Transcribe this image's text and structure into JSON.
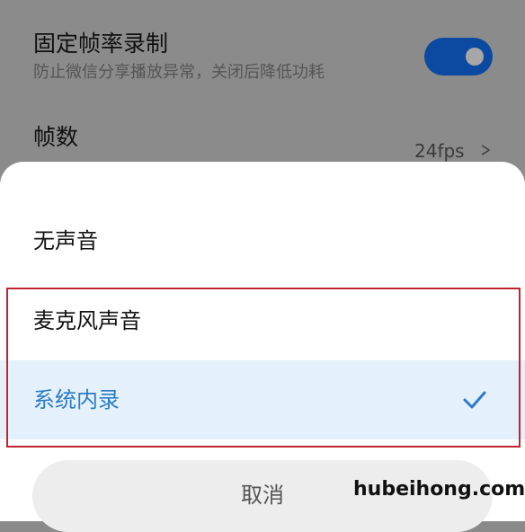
{
  "background_settings": {
    "fixed_frame_rate": {
      "title": "固定帧率录制",
      "subtitle": "防止微信分享播放异常，关闭后降低功耗",
      "toggle_on": true
    },
    "frame_rate": {
      "title": "帧数",
      "value": "24fps"
    }
  },
  "sound_sheet": {
    "options": [
      {
        "label": "无声音",
        "selected": false
      },
      {
        "label": "麦克风声音",
        "selected": false
      },
      {
        "label": "系统内录",
        "selected": true
      }
    ],
    "cancel_label": "取消"
  },
  "watermark": "hubeihong.com",
  "colors": {
    "accent": "#2b7bc6",
    "selected_bg": "#e4f0fb",
    "toggle_on": "#0b4aa0",
    "annotation_red": "#c02430"
  }
}
